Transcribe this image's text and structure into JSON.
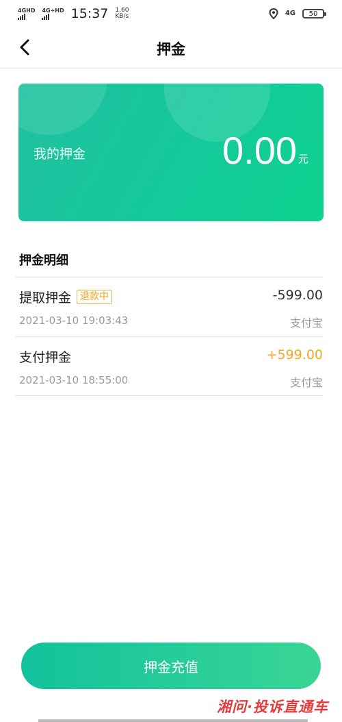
{
  "status_bar": {
    "net1": "4GHD",
    "net2": "4G+HD",
    "time": "15:37",
    "speed_value": "1.60",
    "speed_unit": "KB/s",
    "net3": "4G",
    "battery": "50"
  },
  "nav": {
    "title": "押金"
  },
  "deposit_card": {
    "label": "我的押金",
    "amount": "0.00",
    "unit": "元",
    "colors": {
      "start": "#20c0a0",
      "end": "#0fd28f"
    }
  },
  "details": {
    "title": "押金明细",
    "items": [
      {
        "title": "提取押金",
        "tag": "退款中",
        "amount": "-599.00",
        "time": "2021-03-10 19:03:43",
        "method": "支付宝"
      },
      {
        "title": "支付押金",
        "tag": "",
        "amount": "+599.00",
        "time": "2021-03-10 18:55:00",
        "method": "支付宝"
      }
    ]
  },
  "footer": {
    "recharge_label": "押金充值",
    "watermark": "湘问·投诉直通车"
  },
  "colors": {
    "accent_green": "#14c99b",
    "positive_amount": "#f5a623",
    "tag_orange": "#f0a020"
  }
}
